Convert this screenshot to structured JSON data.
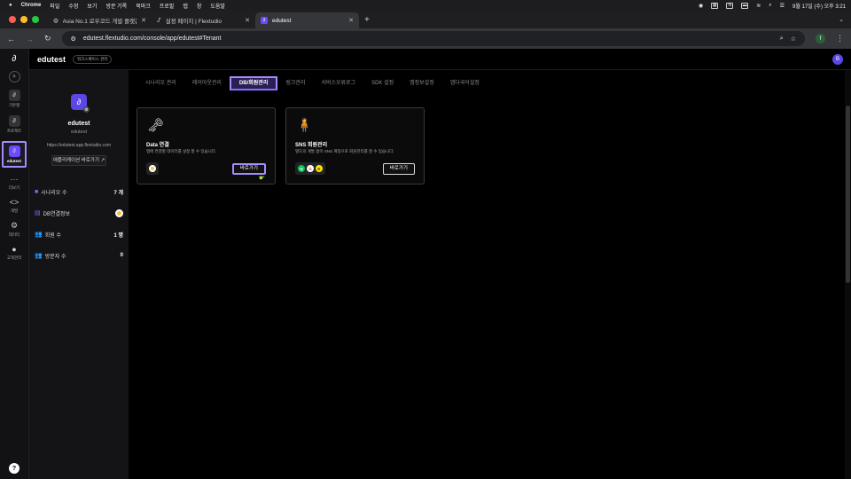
{
  "menubar": {
    "app": "Chrome",
    "items": [
      "파일",
      "수정",
      "보기",
      "방문 기록",
      "북마크",
      "프로필",
      "탭",
      "창",
      "도움말"
    ],
    "clock": "9월 17일 (수) 오후 3:21",
    "icons": [
      "record-icon",
      "grid-icon",
      "n-icon",
      "wifi-icon",
      "search-icon",
      "control-center-icon",
      "battery-icon"
    ]
  },
  "browser": {
    "tabs": [
      {
        "title": "Asia No.1 로우코드 개발 플랫폼 플렉..."
      },
      {
        "title": "설정 페이지 | Flextudio"
      },
      {
        "title": "edutest"
      }
    ],
    "url": "edutest.flextudio.com/console/app/edutest#Tenant",
    "profile_initial": "f"
  },
  "app": {
    "workspace_name": "edutest",
    "workspace_badge": "워크스페이스 관리",
    "user_initial": "B",
    "rail": {
      "items": [
        {
          "label": "기본앱"
        },
        {
          "label": "프로젝트"
        },
        {
          "label": "edutest"
        }
      ],
      "tools": [
        {
          "label": "더보기",
          "glyph": "···"
        },
        {
          "label": "개발",
          "glyph": "<>"
        },
        {
          "label": "데이터",
          "glyph": "⚙"
        },
        {
          "label": "고객관리",
          "glyph": "●"
        }
      ],
      "help": "?"
    },
    "side": {
      "app_name": "edutest",
      "app_sub": "edutest",
      "app_url": "https://edutest.app.flextudio.com",
      "preview_button": "애플리케이션 바로가기 ↗",
      "stats": [
        {
          "label": "시나리오 수",
          "value": "7 개"
        },
        {
          "label": "DB연결정보",
          "value": ""
        },
        {
          "label": "회원 수",
          "value": "1 명"
        },
        {
          "label": "방문자 수",
          "value": "0"
        }
      ]
    },
    "tabs": [
      "시나리오 관리",
      "레이아웃관리",
      "DB/회원관리",
      "링크관리",
      "서비스오류로그",
      "SDK 설정",
      "앱정보설정",
      "앱다국어설정"
    ],
    "active_tab": "DB/회원관리",
    "cards": [
      {
        "title": "Data 연결",
        "desc": "앱에 연결할 데이터를 설정 할 수 있습니다.",
        "button": "바로가기",
        "icon": "🗝"
      },
      {
        "title": "SNS 회원관리",
        "desc": "별도의 개발 없이 SNS 계정으로 회원관리를 할 수 있습니다.",
        "button": "바로가기",
        "icon": "🧍",
        "chips": [
          "N",
          "G",
          "K"
        ]
      }
    ]
  }
}
